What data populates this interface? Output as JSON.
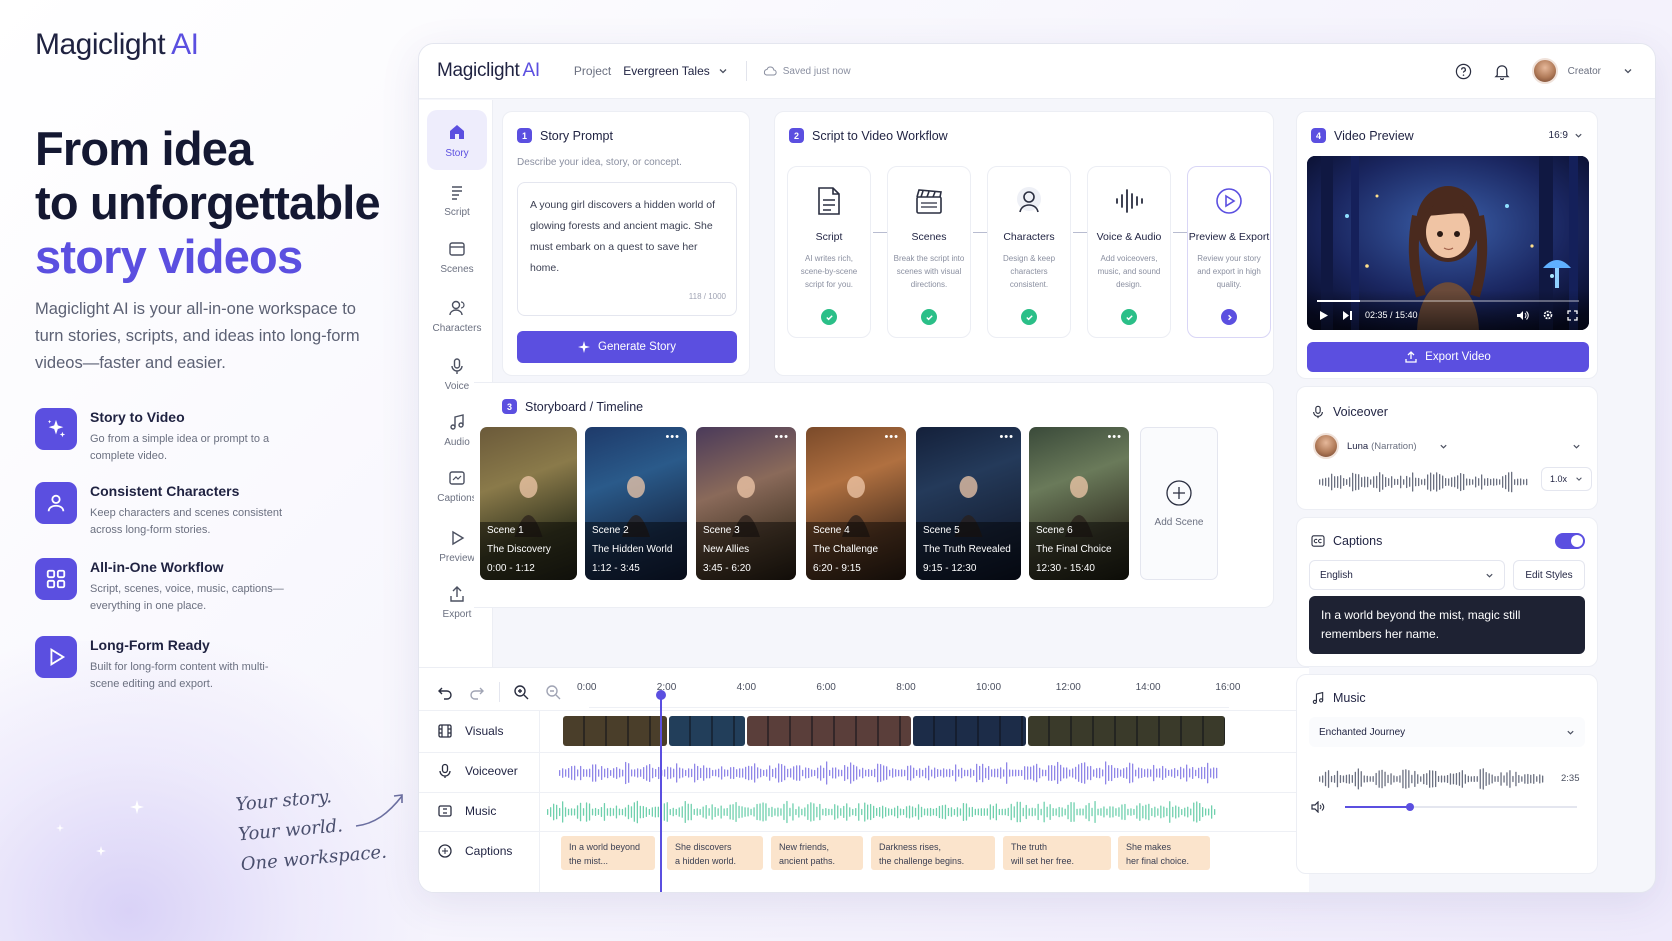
{
  "brand": {
    "name": "Magiclight",
    "suffix": "AI"
  },
  "hero": {
    "line1": "From idea",
    "line2": "to unforgettable",
    "line3": "story videos",
    "subcopy": "Magiclight AI is your all-in-one workspace to turn stories, scripts, and ideas into long-form videos—faster and easier."
  },
  "features": [
    {
      "icon": "sparkles-icon",
      "title": "Story to Video",
      "desc": "Go from a simple idea or prompt to a complete video."
    },
    {
      "icon": "user-icon",
      "title": "Consistent Characters",
      "desc": "Keep characters and scenes consistent across long-form stories."
    },
    {
      "icon": "grid-icon",
      "title": "All-in-One Workflow",
      "desc": "Script, scenes, voice, music, captions—everything in one place."
    },
    {
      "icon": "play-icon",
      "title": "Long-Form Ready",
      "desc": "Built for long-form content with multi-scene editing and export."
    }
  ],
  "tagline": {
    "l1": "Your story.",
    "l2": "Your world.",
    "l3": "One workspace."
  },
  "topbar": {
    "logo": "Magiclight",
    "logo_suffix": "AI",
    "project_label": "Project",
    "project_name": "Evergreen Tales",
    "saved": "Saved just now",
    "user": "Creator"
  },
  "nav": [
    {
      "label": "Story",
      "icon": "home-icon",
      "active": true
    },
    {
      "label": "Script",
      "icon": "script-icon"
    },
    {
      "label": "Scenes",
      "icon": "scenes-icon"
    },
    {
      "label": "Characters",
      "icon": "characters-icon"
    },
    {
      "label": "Voice",
      "icon": "microphone-icon"
    },
    {
      "label": "Audio",
      "icon": "music-note-icon"
    },
    {
      "label": "Captions",
      "icon": "captions-icon"
    },
    {
      "label": "Preview",
      "icon": "play-icon"
    },
    {
      "label": "Export",
      "icon": "export-icon"
    }
  ],
  "story_prompt": {
    "num": "1",
    "title": "Story Prompt",
    "subtitle": "Describe your idea, story, or concept.",
    "text": "A young girl discovers a hidden world of glowing forests and ancient magic. She must embark on a quest to save her home.",
    "count": "118 / 1000",
    "button": "Generate Story"
  },
  "workflow": {
    "num": "2",
    "title": "Script to Video Workflow",
    "steps": [
      {
        "name": "Script",
        "desc": "AI writes rich, scene-by-scene script for you.",
        "icon": "document-icon",
        "status": "done"
      },
      {
        "name": "Scenes",
        "desc": "Break the script into scenes with visual directions.",
        "icon": "clapperboard-icon",
        "status": "done"
      },
      {
        "name": "Characters",
        "desc": "Design & keep characters consistent.",
        "icon": "character-icon",
        "status": "done"
      },
      {
        "name": "Voice & Audio",
        "desc": "Add voiceovers, music, and sound design.",
        "icon": "soundwave-icon",
        "status": "done"
      },
      {
        "name": "Preview & Export",
        "desc": "Review your story and export in high quality.",
        "icon": "play-circle-icon",
        "status": "current"
      }
    ]
  },
  "storyboard": {
    "num": "3",
    "title": "Storyboard / Timeline",
    "scenes": [
      {
        "n": "Scene 1",
        "t": "The Discovery",
        "r": "0:00 - 1:12"
      },
      {
        "n": "Scene 2",
        "t": "The Hidden World",
        "r": "1:12 - 3:45"
      },
      {
        "n": "Scene 3",
        "t": "New Allies",
        "r": "3:45 - 6:20"
      },
      {
        "n": "Scene 4",
        "t": "The Challenge",
        "r": "6:20 - 9:15"
      },
      {
        "n": "Scene 5",
        "t": "The Truth Revealed",
        "r": "9:15 - 12:30"
      },
      {
        "n": "Scene 6",
        "t": "The Final Choice",
        "r": "12:30 - 15:40"
      }
    ],
    "add_label": "Add Scene"
  },
  "timeline": {
    "ticks": [
      "0:00",
      "2:00",
      "4:00",
      "6:00",
      "8:00",
      "10:00",
      "12:00",
      "14:00",
      "16:00"
    ],
    "playhead": "2:00",
    "rows": [
      {
        "label": "Visuals",
        "icon": "film-icon"
      },
      {
        "label": "Voiceover",
        "icon": "microphone-icon"
      },
      {
        "label": "Music",
        "icon": "music-icon"
      },
      {
        "label": "Captions",
        "icon": "captions-icon"
      }
    ],
    "captions": [
      {
        "l1": "In a world beyond",
        "l2": "the mist..."
      },
      {
        "l1": "She discovers",
        "l2": "a hidden world."
      },
      {
        "l1": "New friends,",
        "l2": "ancient paths."
      },
      {
        "l1": "Darkness rises,",
        "l2": "the challenge begins."
      },
      {
        "l1": "The truth",
        "l2": "will set her free."
      },
      {
        "l1": "She makes",
        "l2": "her final choice."
      }
    ]
  },
  "video_preview": {
    "num": "4",
    "title": "Video Preview",
    "ratio": "16:9",
    "time": "02:35 / 15:40",
    "progress": 0.165,
    "export": "Export Video"
  },
  "voiceover": {
    "title": "Voiceover",
    "voice": "Luna",
    "voice_role": "(Narration)",
    "speed": "1.0x"
  },
  "captions_panel": {
    "title": "Captions",
    "enabled": true,
    "language": "English",
    "edit": "Edit Styles",
    "preview": "In a world beyond the mist, magic still remembers her name."
  },
  "music": {
    "title": "Music",
    "track": "Enchanted Journey",
    "duration": "2:35",
    "volume": 0.28
  },
  "colors": {
    "accent": "#5b4fe0",
    "success": "#2bbf88",
    "caption_clip": "#fbe4cc"
  }
}
